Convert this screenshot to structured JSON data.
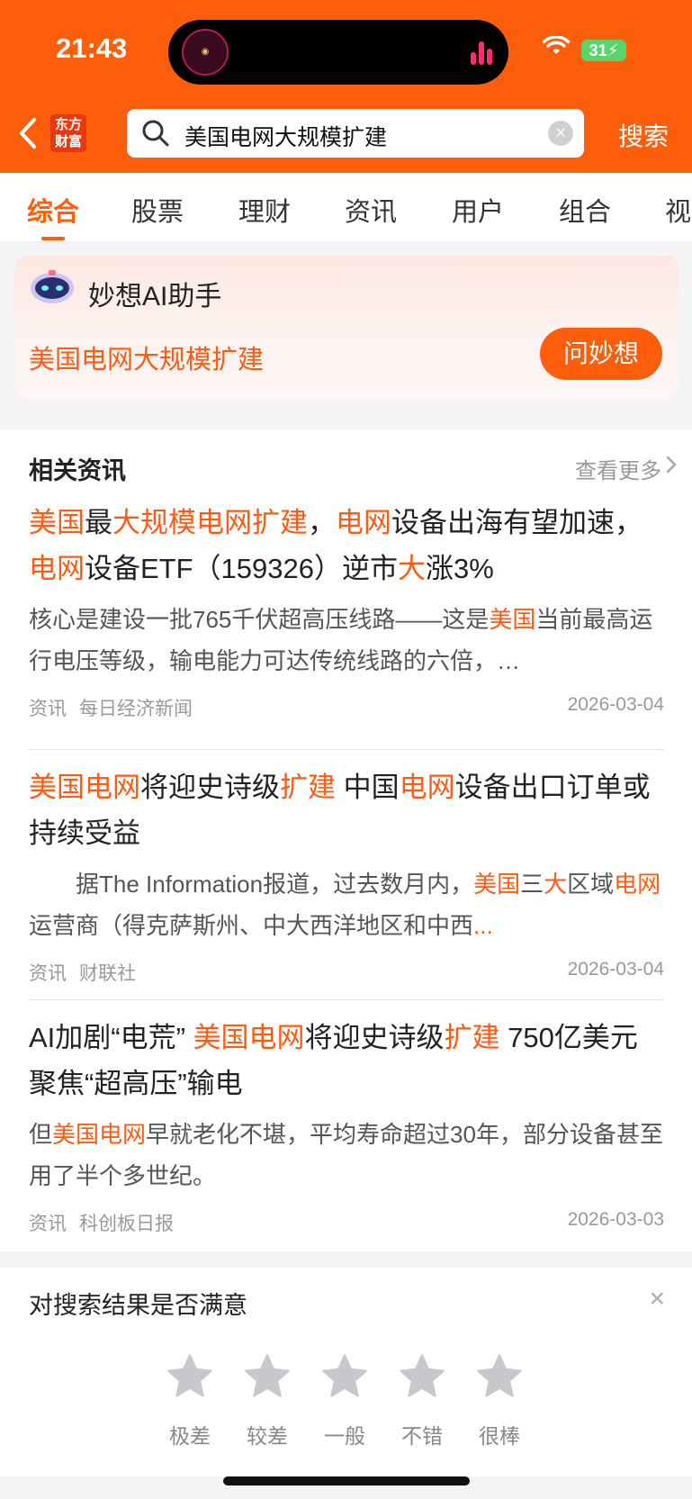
{
  "status": {
    "time": "21:43",
    "battery": "31"
  },
  "header": {
    "logo": "东方财富",
    "query": "美国电网大规模扩建",
    "search_label": "搜索"
  },
  "tabs": [
    "综合",
    "股票",
    "理财",
    "资讯",
    "用户",
    "组合",
    "视"
  ],
  "ai": {
    "title": "妙想AI助手",
    "query": "美国电网大规模扩建",
    "button": "问妙想"
  },
  "news": {
    "header": "相关资讯",
    "more": "查看更多",
    "items": [
      {
        "title_parts": [
          [
            "美国",
            1
          ],
          [
            "最",
            0
          ],
          [
            "大规模电网扩建",
            1
          ],
          [
            "，",
            0
          ],
          [
            "电网",
            1
          ],
          [
            "设备出海有望加速，",
            0
          ],
          [
            "电网",
            1
          ],
          [
            "设备ETF（159326）逆市",
            0
          ],
          [
            "大",
            1
          ],
          [
            "涨3%",
            0
          ]
        ],
        "body_parts": [
          [
            "核心是建设一批765千伏超高压线路——这是",
            0
          ],
          [
            "美国",
            1
          ],
          [
            "当前最高运行电压等级，输电能力可达传统线路的六倍，…",
            0
          ]
        ],
        "category": "资讯",
        "source": "每日经济新闻",
        "date": "2026-03-04"
      },
      {
        "title_parts": [
          [
            "美国电网",
            1
          ],
          [
            "将迎史诗级",
            0
          ],
          [
            "扩建",
            1
          ],
          [
            " 中国",
            0
          ],
          [
            "电网",
            1
          ],
          [
            "设备出口订单或持续受益",
            0
          ]
        ],
        "body_parts": [
          [
            "　　据The Information报道，过去数月内，",
            0
          ],
          [
            "美国",
            1
          ],
          [
            "三",
            0
          ],
          [
            "大",
            1
          ],
          [
            "区域",
            0
          ],
          [
            "电网",
            1
          ],
          [
            "运营商（得克萨斯州、中大西洋地区和中西",
            0
          ],
          [
            "...",
            1
          ]
        ],
        "category": "资讯",
        "source": "财联社",
        "date": "2026-03-04"
      },
      {
        "title_parts": [
          [
            "AI加剧“电荒” ",
            0
          ],
          [
            "美国电网",
            1
          ],
          [
            "将迎史诗级",
            0
          ],
          [
            "扩建",
            1
          ],
          [
            " 750亿美元聚焦“超高压”输电",
            0
          ]
        ],
        "body_parts": [
          [
            "但",
            0
          ],
          [
            "美国电网",
            1
          ],
          [
            "早就老化不堪，平均寿命超过30年，部分设备甚至用了半个多世纪。",
            0
          ]
        ],
        "category": "资讯",
        "source": "科创板日报",
        "date": "2026-03-03"
      }
    ]
  },
  "feedback": {
    "title": "对搜索结果是否满意",
    "close": "×",
    "ratings": [
      "极差",
      "较差",
      "一般",
      "不错",
      "很棒"
    ]
  }
}
